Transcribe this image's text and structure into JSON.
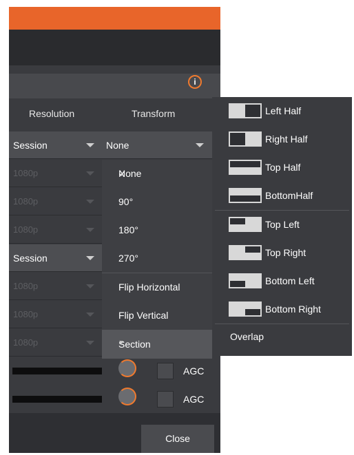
{
  "header": {
    "resolution_label": "Resolution",
    "transform_label": "Transform"
  },
  "rows": [
    {
      "resolution": "Session",
      "dim": false,
      "transform": "None"
    },
    {
      "resolution": "1080p",
      "dim": true
    },
    {
      "resolution": "1080p",
      "dim": true
    },
    {
      "resolution": "1080p",
      "dim": true
    },
    {
      "resolution": "Session",
      "dim": false
    },
    {
      "resolution": "1080p",
      "dim": true
    },
    {
      "resolution": "1080p",
      "dim": true
    },
    {
      "resolution": "1080p",
      "dim": true
    }
  ],
  "transform_menu": {
    "selected": "None",
    "items": [
      "None",
      "90°",
      "180°",
      "270°",
      "Flip Horizontal",
      "Flip Vertical",
      "Section"
    ]
  },
  "section_menu": {
    "items": [
      "Left Half",
      "Right Half",
      "Top Half",
      "BottomHalf",
      "Top Left",
      "Top Right",
      "Bottom Left",
      "Bottom Right"
    ],
    "overlap_label": "Overlap"
  },
  "audio": {
    "agc_label": "AGC"
  },
  "footer": {
    "close_label": "Close"
  },
  "colors": {
    "accent": "#e8652a",
    "panel": "#3a3b3f"
  }
}
